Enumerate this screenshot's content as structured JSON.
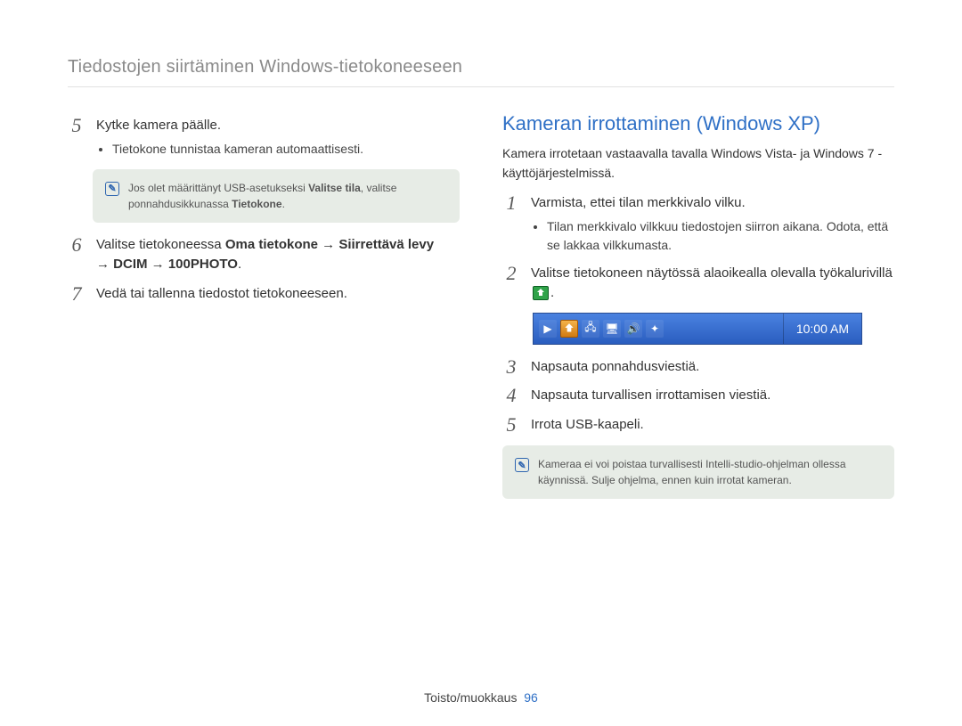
{
  "header": "Tiedostojen siirtäminen Windows-tietokoneeseen",
  "left": {
    "step5": {
      "num": "5",
      "title": "Kytke kamera päälle.",
      "bullet": "Tietokone tunnistaa kameran automaattisesti."
    },
    "info": {
      "pre": "Jos olet määrittänyt USB-asetukseksi ",
      "bold1": "Valitse tila",
      "mid": ", valitse ponnahdusikkunassa ",
      "bold2": "Tietokone",
      "post": "."
    },
    "step6": {
      "num": "6",
      "pre": "Valitse tietokoneessa ",
      "path1": "Oma tietokone",
      "arrow": " → ",
      "path2": "Siirrettävä levy",
      "path3": "DCIM",
      "path4": "100PHOTO",
      "end": "."
    },
    "step7": {
      "num": "7",
      "title": "Vedä tai tallenna tiedostot tietokoneeseen."
    }
  },
  "right": {
    "title": "Kameran irrottaminen (Windows XP)",
    "intro": "Kamera irrotetaan vastaavalla tavalla Windows Vista- ja Windows 7 -käyttöjärjestelmissä.",
    "step1": {
      "num": "1",
      "title": "Varmista, ettei tilan merkkivalo vilku.",
      "bullet": "Tilan merkkivalo vilkkuu tiedostojen siirron aikana. Odota, että se lakkaa vilkkumasta."
    },
    "step2": {
      "num": "2",
      "pre": "Valitse tietokoneen näytössä alaoikealla olevalla työkalurivillä ",
      "post": "."
    },
    "clock": "10:00 AM",
    "step3": {
      "num": "3",
      "title": "Napsauta ponnahdusviestiä."
    },
    "step4": {
      "num": "4",
      "title": "Napsauta turvallisen irrottamisen viestiä."
    },
    "step5": {
      "num": "5",
      "title": "Irrota USB-kaapeli."
    },
    "info": "Kameraa ei voi poistaa turvallisesti Intelli-studio-ohjelman ollessa käynnissä. Sulje ohjelma, ennen kuin irrotat kameran."
  },
  "footer": {
    "section": "Toisto/muokkaus",
    "page": "96"
  }
}
